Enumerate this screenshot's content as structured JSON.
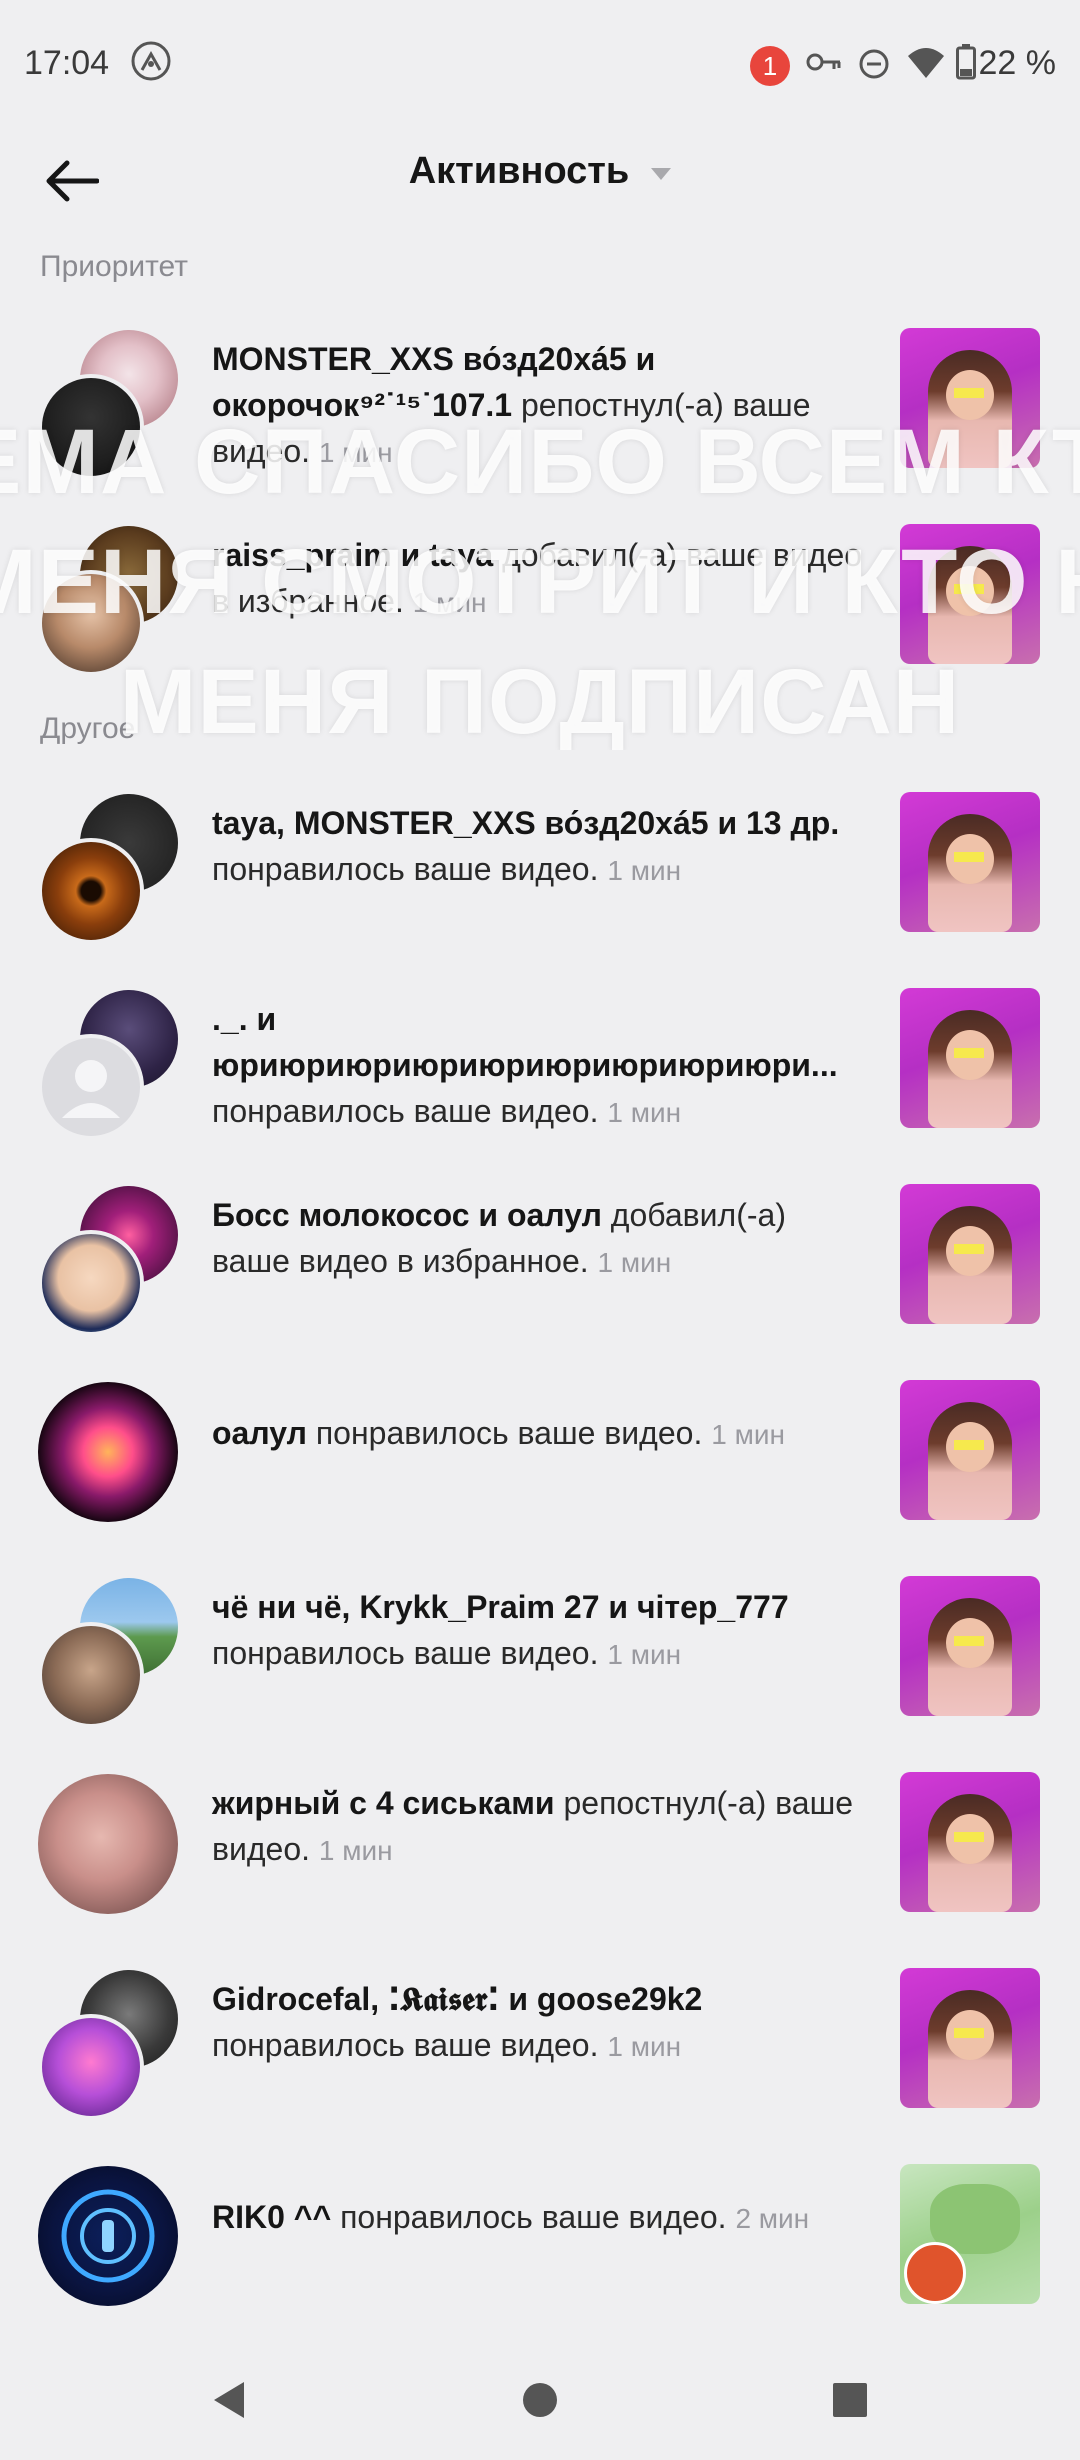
{
  "status": {
    "time": "17:04",
    "notif_count": "1",
    "battery": "22 %"
  },
  "header": {
    "title": "Активность"
  },
  "sections": {
    "priority": "Приоритет",
    "other": "Другое"
  },
  "overlay": {
    "line1": "ЕМА СПАСИБО ВСЕМ КТО",
    "line2": "МЕНЯ СМОТРИТ И КТО НА",
    "line3": "МЕНЯ ПОДПИСАН"
  },
  "priority_items": [
    {
      "name": "MONSTER_XXS во́зд20хá5 и окорочок⁹²˙¹⁵˙107.1",
      "action": " репостнул(-а) ваше видео.",
      "time": "1 мин"
    },
    {
      "name": "raiss_praim и taya",
      "action": " добавил(-а) ваше видео в избранное.",
      "time": "1 мин"
    }
  ],
  "items": [
    {
      "name": "taya, MONSTER_XXS во́зд20хá5 и 13 др.",
      "action": " понравилось ваше видео.",
      "time": "1 мин"
    },
    {
      "name": "._. и юриюриюриюриюриюриюриюриюри...",
      "action": " понравилось ваше видео.",
      "time": "1 мин"
    },
    {
      "name": "Босс молокосос и оалул",
      "action": " добавил(-а) ваше видео в избранное.",
      "time": "1 мин"
    },
    {
      "name": "оалул",
      "action": " понравилось ваше видео.",
      "time": "1 мин"
    },
    {
      "name": "чё ни чё, Krykk_Praim 27 и чітер_777",
      "action": " понравилось ваше видео.",
      "time": "1 мин"
    },
    {
      "name": "жирный с 4 сиськами",
      "action": " репостнул(-а) ваше видео.",
      "time": "1 мин"
    },
    {
      "name": "Gidrocefal, ⁚𝕶𝖆𝖎𝖘𝖊𝖗⁚ и goose29k2",
      "action": " понравилось ваше видео.",
      "time": "1 мин"
    },
    {
      "name": "RIK0 ^^",
      "action": " понравилось ваше видео.",
      "time": "2 мин"
    }
  ],
  "colors": {
    "background": "#efeff1",
    "badge": "#e8453c",
    "thumb_purple": "#c236d0"
  }
}
